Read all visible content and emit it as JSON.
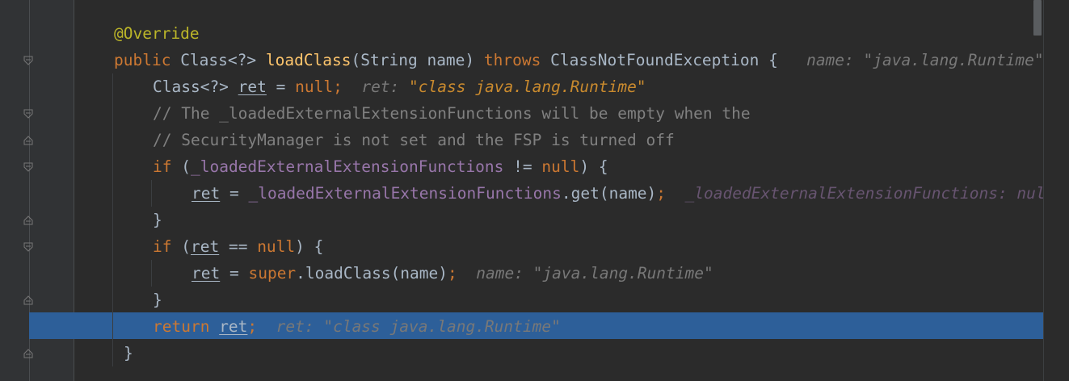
{
  "editor": {
    "lines": [
      {
        "tokens": [
          {
            "t": "@Override",
            "c": "ann"
          }
        ]
      },
      {
        "tokens": [
          {
            "t": "public ",
            "c": "kw"
          },
          {
            "t": "Class<?> ",
            "c": ""
          },
          {
            "t": "loadClass",
            "c": "fn"
          },
          {
            "t": "(String name) ",
            "c": ""
          },
          {
            "t": "throws ",
            "c": "kw"
          },
          {
            "t": "ClassNotFoundException {",
            "c": ""
          },
          {
            "t": "   name: \"java.lang.Runtime\"",
            "c": "hint"
          }
        ]
      },
      {
        "tokens": [
          {
            "t": "Class<?> ",
            "c": ""
          },
          {
            "t": "ret",
            "c": "var"
          },
          {
            "t": " = ",
            "c": ""
          },
          {
            "t": "null",
            "c": "kw"
          },
          {
            "t": ";",
            "c": "kw"
          },
          {
            "t": "  ret: ",
            "c": "hint"
          },
          {
            "t": "\"class java.lang.Runtime\"",
            "c": "hint-str"
          }
        ]
      },
      {
        "tokens": [
          {
            "t": "// The _loadedExternalExtensionFunctions will be empty when the",
            "c": "cm"
          }
        ]
      },
      {
        "tokens": [
          {
            "t": "// SecurityManager is not set and the FSP is turned off",
            "c": "cm"
          }
        ]
      },
      {
        "tokens": [
          {
            "t": "if ",
            "c": "kw"
          },
          {
            "t": "(",
            "c": ""
          },
          {
            "t": "_loadedExternalExtensionFunctions",
            "c": "fld"
          },
          {
            "t": " != ",
            "c": ""
          },
          {
            "t": "null",
            "c": "kw"
          },
          {
            "t": ") {",
            "c": ""
          }
        ]
      },
      {
        "tokens": [
          {
            "t": "ret",
            "c": "var"
          },
          {
            "t": " = ",
            "c": ""
          },
          {
            "t": "_loadedExternalExtensionFunctions",
            "c": "fld"
          },
          {
            "t": ".get(name)",
            "c": ""
          },
          {
            "t": ";",
            "c": "kw"
          },
          {
            "t": "  _loadedExternalExtensionFunctions: null",
            "c": "hint-fld"
          }
        ]
      },
      {
        "tokens": [
          {
            "t": "}",
            "c": ""
          }
        ]
      },
      {
        "tokens": [
          {
            "t": "if ",
            "c": "kw"
          },
          {
            "t": "(",
            "c": ""
          },
          {
            "t": "ret",
            "c": "var"
          },
          {
            "t": " == ",
            "c": ""
          },
          {
            "t": "null",
            "c": "kw"
          },
          {
            "t": ") {",
            "c": ""
          }
        ]
      },
      {
        "tokens": [
          {
            "t": "ret",
            "c": "var"
          },
          {
            "t": " = ",
            "c": ""
          },
          {
            "t": "super",
            "c": "kw"
          },
          {
            "t": ".loadClass(name)",
            "c": ""
          },
          {
            "t": ";",
            "c": "kw"
          },
          {
            "t": "  name: \"java.lang.Runtime\"",
            "c": "hint"
          }
        ]
      },
      {
        "tokens": [
          {
            "t": "}",
            "c": ""
          }
        ]
      },
      {
        "tokens": [
          {
            "t": "return ",
            "c": "kw"
          },
          {
            "t": "ret",
            "c": "var"
          },
          {
            "t": ";",
            "c": "kw"
          },
          {
            "t": "  ret: \"class java.lang.Runtime\"",
            "c": "hint"
          }
        ]
      },
      {
        "tokens": [
          {
            "t": "}",
            "c": ""
          }
        ]
      }
    ]
  },
  "colors": {
    "background": "#2b2b2b",
    "gutter": "#313335",
    "execution_line": "#2d5f99",
    "keyword": "#cc7832",
    "annotation": "#bbb529",
    "method": "#ffc66d",
    "comment": "#808080",
    "field": "#9876aa",
    "text": "#a9b7c6"
  },
  "icons": {
    "fold_open": "fold-open-icon",
    "fold_close": "fold-close-icon"
  }
}
